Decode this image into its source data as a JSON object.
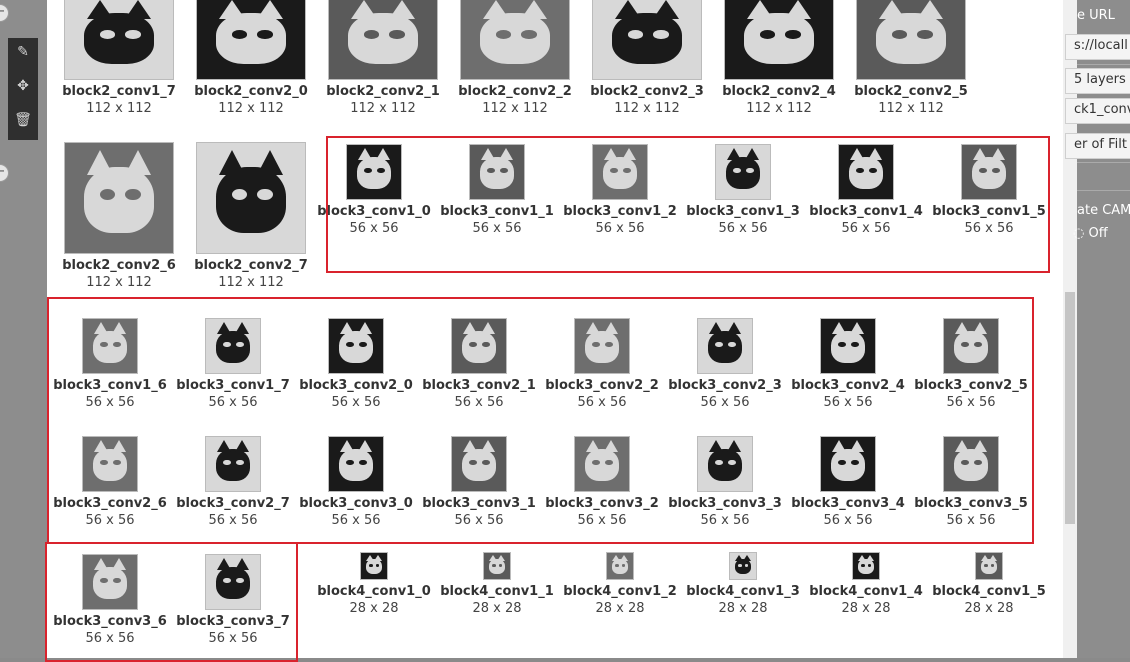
{
  "right_panel": {
    "lines": [
      "e URL",
      "s://locall",
      "5 layers",
      "ck1_conv",
      "er of Filt",
      "ate CAM",
      "Off"
    ]
  },
  "tools": {
    "edit_icon": "pencil-icon",
    "move_icon": "move-icon",
    "delete_icon": "trash-icon"
  },
  "thumb_colors": {
    "dark": "#1a1a1a",
    "mid": "#5a5a5a",
    "light": "#d8d8d8",
    "gray": "#6e6e6e"
  },
  "filters": [
    {
      "name": "block2_conv1_7",
      "size": "112 x 112"
    },
    {
      "name": "block2_conv2_0",
      "size": "112 x 112"
    },
    {
      "name": "block2_conv2_1",
      "size": "112 x 112"
    },
    {
      "name": "block2_conv2_2",
      "size": "112 x 112"
    },
    {
      "name": "block2_conv2_3",
      "size": "112 x 112"
    },
    {
      "name": "block2_conv2_4",
      "size": "112 x 112"
    },
    {
      "name": "block2_conv2_5",
      "size": "112 x 112"
    },
    {
      "name": "block2_conv2_6",
      "size": "112 x 112"
    },
    {
      "name": "block2_conv2_7",
      "size": "112 x 112"
    },
    {
      "name": "block3_conv1_0",
      "size": "56 x 56"
    },
    {
      "name": "block3_conv1_1",
      "size": "56 x 56"
    },
    {
      "name": "block3_conv1_2",
      "size": "56 x 56"
    },
    {
      "name": "block3_conv1_3",
      "size": "56 x 56"
    },
    {
      "name": "block3_conv1_4",
      "size": "56 x 56"
    },
    {
      "name": "block3_conv1_5",
      "size": "56 x 56"
    },
    {
      "name": "block3_conv1_6",
      "size": "56 x 56"
    },
    {
      "name": "block3_conv1_7",
      "size": "56 x 56"
    },
    {
      "name": "block3_conv2_0",
      "size": "56 x 56"
    },
    {
      "name": "block3_conv2_1",
      "size": "56 x 56"
    },
    {
      "name": "block3_conv2_2",
      "size": "56 x 56"
    },
    {
      "name": "block3_conv2_3",
      "size": "56 x 56"
    },
    {
      "name": "block3_conv2_4",
      "size": "56 x 56"
    },
    {
      "name": "block3_conv2_5",
      "size": "56 x 56"
    },
    {
      "name": "block3_conv2_6",
      "size": "56 x 56"
    },
    {
      "name": "block3_conv2_7",
      "size": "56 x 56"
    },
    {
      "name": "block3_conv3_0",
      "size": "56 x 56"
    },
    {
      "name": "block3_conv3_1",
      "size": "56 x 56"
    },
    {
      "name": "block3_conv3_2",
      "size": "56 x 56"
    },
    {
      "name": "block3_conv3_3",
      "size": "56 x 56"
    },
    {
      "name": "block3_conv3_4",
      "size": "56 x 56"
    },
    {
      "name": "block3_conv3_5",
      "size": "56 x 56"
    },
    {
      "name": "block3_conv3_6",
      "size": "56 x 56"
    },
    {
      "name": "block3_conv3_7",
      "size": "56 x 56"
    },
    {
      "name": "block4_conv1_0",
      "size": "28 x 28"
    },
    {
      "name": "block4_conv1_1",
      "size": "28 x 28"
    },
    {
      "name": "block4_conv1_2",
      "size": "28 x 28"
    },
    {
      "name": "block4_conv1_3",
      "size": "28 x 28"
    },
    {
      "name": "block4_conv1_4",
      "size": "28 x 28"
    },
    {
      "name": "block4_conv1_5",
      "size": "28 x 28"
    }
  ]
}
